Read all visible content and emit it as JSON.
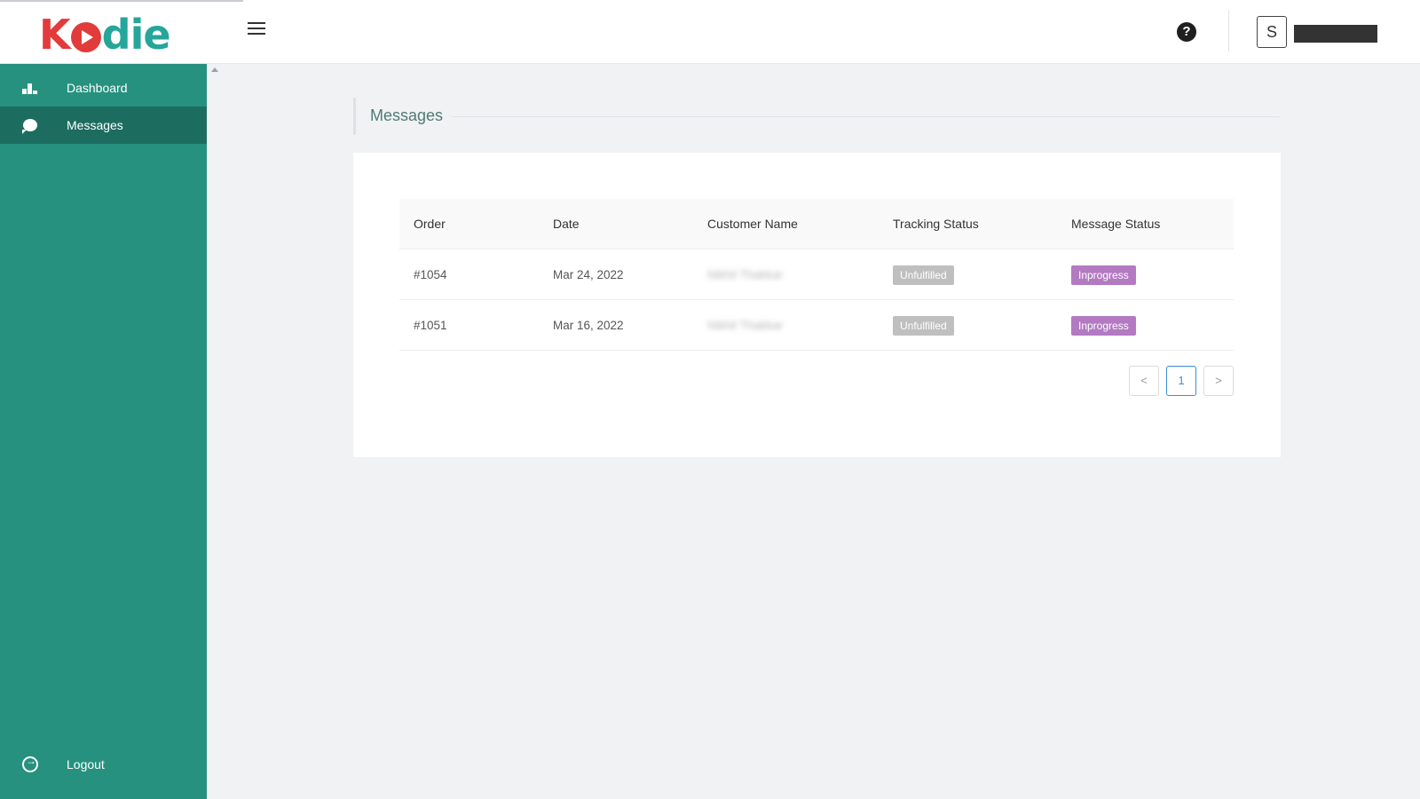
{
  "brand": {
    "logo_k": "K",
    "logo_rest": "die",
    "accent": "#26917f",
    "logo_red": "#e23b3b"
  },
  "header": {
    "help_label": "?",
    "avatar_initial": "S"
  },
  "sidebar": {
    "items": [
      {
        "label": "Dashboard",
        "icon": "bar-chart-icon",
        "active": false
      },
      {
        "label": "Messages",
        "icon": "chat-bubble-icon",
        "active": true
      }
    ],
    "logout_label": "Logout"
  },
  "main": {
    "title": "Messages",
    "table": {
      "columns": [
        "Order",
        "Date",
        "Customer Name",
        "Tracking Status",
        "Message Status"
      ],
      "rows": [
        {
          "order": "#1054",
          "date": "Mar 24, 2022",
          "customer": "Nikhil Thakkar",
          "tracking": "Unfulfilled",
          "message_status": "Inprogress"
        },
        {
          "order": "#1051",
          "date": "Mar 16, 2022",
          "customer": "Nikhil Thakkar",
          "tracking": "Unfulfilled",
          "message_status": "Inprogress"
        }
      ]
    },
    "pagination": {
      "prev": "<",
      "current": "1",
      "next": ">"
    },
    "colors": {
      "unfulfilled": "#bfbfbf",
      "inprogress": "#b37ac2"
    }
  }
}
